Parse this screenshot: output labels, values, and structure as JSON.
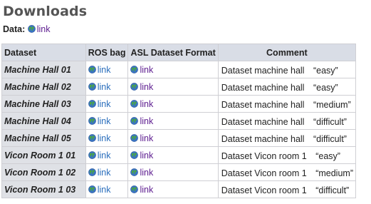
{
  "heading": "Downloads",
  "data_label": "Data:",
  "data_link": "link",
  "columns": [
    "Dataset",
    "ROS bag",
    "ASL Dataset Format",
    "Comment"
  ],
  "rows": [
    {
      "dataset": "Machine Hall 01",
      "ros": "link",
      "asl": "link",
      "comment": "Dataset machine hall　“easy”"
    },
    {
      "dataset": "Machine Hall 02",
      "ros": "link",
      "asl": "link",
      "comment": "Dataset machine hall　“easy”"
    },
    {
      "dataset": "Machine Hall 03",
      "ros": "link",
      "asl": "link",
      "comment": "Dataset machine hall　“medium”"
    },
    {
      "dataset": "Machine Hall 04",
      "ros": "link",
      "asl": "link",
      "comment": "Dataset machine hall　“difficult”"
    },
    {
      "dataset": "Machine Hall 05",
      "ros": "link",
      "asl": "link",
      "comment": "Dataset machine hall　“difficult”"
    },
    {
      "dataset": "Vicon Room 1 01",
      "ros": "link",
      "asl": "link",
      "comment": "Dataset Vicon room 1　“easy”"
    },
    {
      "dataset": "Vicon Room 1 02",
      "ros": "link",
      "asl": "link",
      "comment": "Dataset Vicon room 1　“medium”"
    },
    {
      "dataset": "Vicon Room 1 03",
      "ros": "link",
      "asl": "link",
      "comment": "Dataset Vicon room 1　“difficult”"
    }
  ],
  "icon": "globe-icon",
  "colors": {
    "link_visited": "#5c1b8f",
    "link": "#2a6ebc",
    "header_bg": "#d9dde6",
    "name_bg": "#dfe1e6",
    "heading": "#555555"
  }
}
